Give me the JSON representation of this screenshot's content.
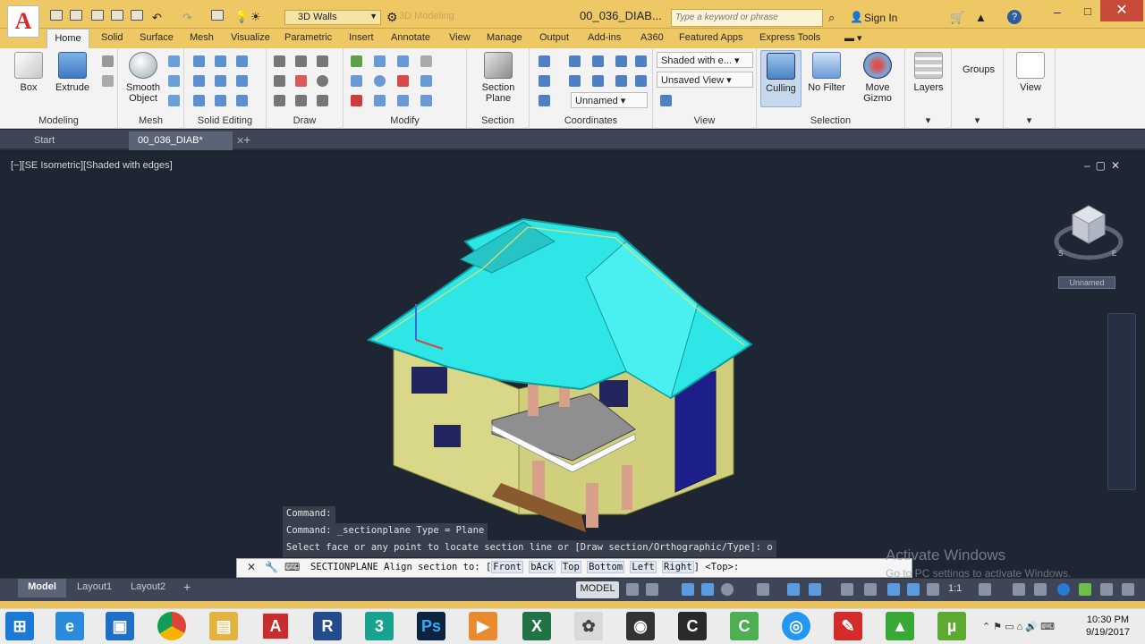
{
  "app": {
    "logo": "A",
    "title": "00_036_DIAB...",
    "workspace": "3D Walls",
    "workspace2": "3D Modeling",
    "search_placeholder": "Type a keyword or phrase",
    "signin": "Sign In"
  },
  "tabs": [
    "Home",
    "Solid",
    "Surface",
    "Mesh",
    "Visualize",
    "Parametric",
    "Insert",
    "Annotate",
    "View",
    "Manage",
    "Output",
    "Add-ins",
    "A360",
    "Featured Apps",
    "Express Tools"
  ],
  "ribbon": {
    "box": "Box",
    "extrude": "Extrude",
    "smooth": "Smooth\nObject",
    "section_plane": "Section\nPlane",
    "visual_style": "Shaded with e...",
    "view": "Unsaved View",
    "ucs": "Unnamed",
    "culling": "Culling",
    "no_filter": "No Filter",
    "move_gizmo": "Move\nGizmo",
    "layers": "Layers",
    "groups": "Groups",
    "view_btn": "View",
    "groups_labels": [
      "Modeling",
      "Mesh",
      "Solid Editing",
      "Draw",
      "Modify",
      "Section",
      "Coordinates",
      "View",
      "Selection"
    ]
  },
  "filetabs": {
    "start": "Start",
    "file": "00_036_DIAB*"
  },
  "viewport": {
    "label": "[−][SE Isometric][Shaded with edges]",
    "ucs_name": "Unnamed"
  },
  "command": {
    "history": [
      "Command:",
      "Command: _sectionplane Type = Plane",
      "Select face or any point to locate section line or [Draw section/Orthographic/Type]: o"
    ],
    "prompt_pre": "SECTIONPLANE Align section to: [",
    "options": [
      "Front",
      "bAck",
      "Top",
      "Bottom",
      "Left",
      "Right"
    ],
    "prompt_post": "] <Top>:"
  },
  "activation": {
    "line1": "Activate Windows",
    "line2": "Go to PC settings to activate Windows."
  },
  "status": {
    "model_tab": "Model",
    "layout1": "Layout1",
    "layout2": "Layout2",
    "model_btn": "MODEL",
    "scale": "1:1"
  },
  "clock": {
    "time": "10:30 PM",
    "date": "9/19/2017"
  },
  "colors": {
    "roof": "#2ee6e6",
    "wall": "#d9d98a",
    "accent": "#1d1f8a",
    "titlebar": "#efc866"
  }
}
